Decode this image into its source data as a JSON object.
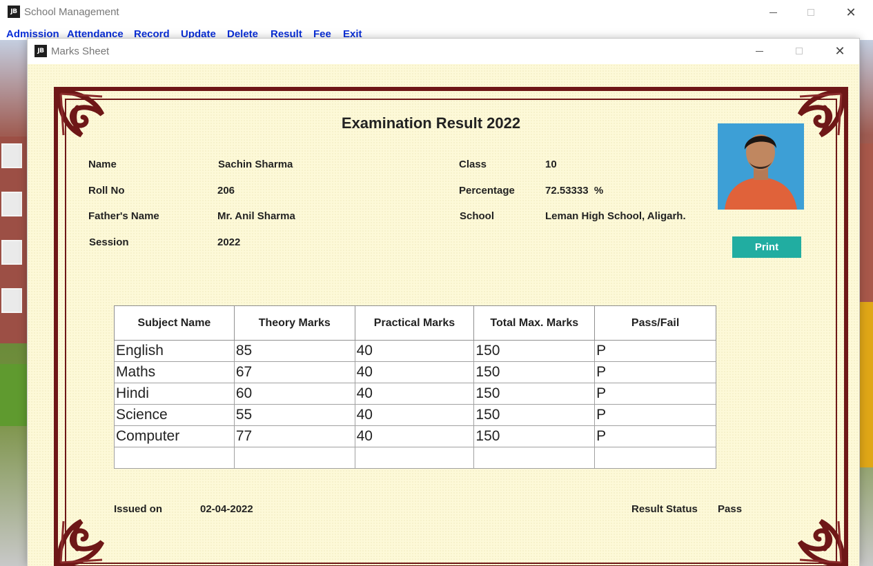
{
  "main_window": {
    "icon_text": "JB",
    "title": "School Management"
  },
  "menu": [
    "Admission",
    "Attendance",
    "Record",
    "Update",
    "Delete",
    "Result",
    "Fee",
    "Exit"
  ],
  "child_window": {
    "icon_text": "JB",
    "title": "Marks Sheet"
  },
  "certificate": {
    "title": "Examination Result  2022",
    "fields": {
      "name_label": "Name",
      "name_value": "Sachin Sharma",
      "roll_label": "Roll No",
      "roll_value": "206",
      "father_label": "Father's Name",
      "father_value": "Mr. Anil Sharma",
      "session_label": "Session",
      "session_value": "2022",
      "class_label": "Class",
      "class_value": "10",
      "percentage_label": "Percentage",
      "percentage_value": "72.53333  %",
      "school_label": "School",
      "school_value": "Leman High School, Aligarh."
    },
    "print_label": "Print",
    "table": {
      "headers": [
        "Subject Name",
        "Theory Marks",
        "Practical Marks",
        "Total Max. Marks",
        "Pass/Fail"
      ],
      "rows": [
        [
          "English",
          "85",
          "40",
          "150",
          "P"
        ],
        [
          "Maths",
          "67",
          "40",
          "150",
          "P"
        ],
        [
          "Hindi",
          "60",
          "40",
          "150",
          "P"
        ],
        [
          "Science",
          "55",
          "40",
          "150",
          "P"
        ],
        [
          "Computer",
          "77",
          "40",
          "150",
          "P"
        ],
        [
          "",
          "",
          "",
          "",
          ""
        ]
      ]
    },
    "issued_label": "Issued on",
    "issued_value": "02-04-2022",
    "status_label": "Result Status",
    "status_value": "Pass"
  },
  "colors": {
    "menu_text": "#0a2fd9",
    "frame": "#6e1717",
    "print_button": "#21ada1",
    "paper": "#fdf9d8"
  }
}
